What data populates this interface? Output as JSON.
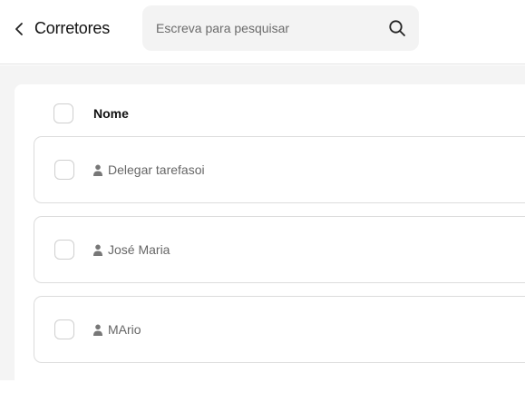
{
  "header": {
    "back_icon": "chevron-left-icon",
    "title": "Corretores",
    "search": {
      "placeholder": "Escreva para pesquisar",
      "icon": "search-icon"
    }
  },
  "table": {
    "column_header": "Nome",
    "rows": [
      {
        "name": "Delegar tarefasoi",
        "icon": "person-icon"
      },
      {
        "name": "José Maria",
        "icon": "person-icon"
      },
      {
        "name": "MArio",
        "icon": "person-icon"
      }
    ]
  }
}
